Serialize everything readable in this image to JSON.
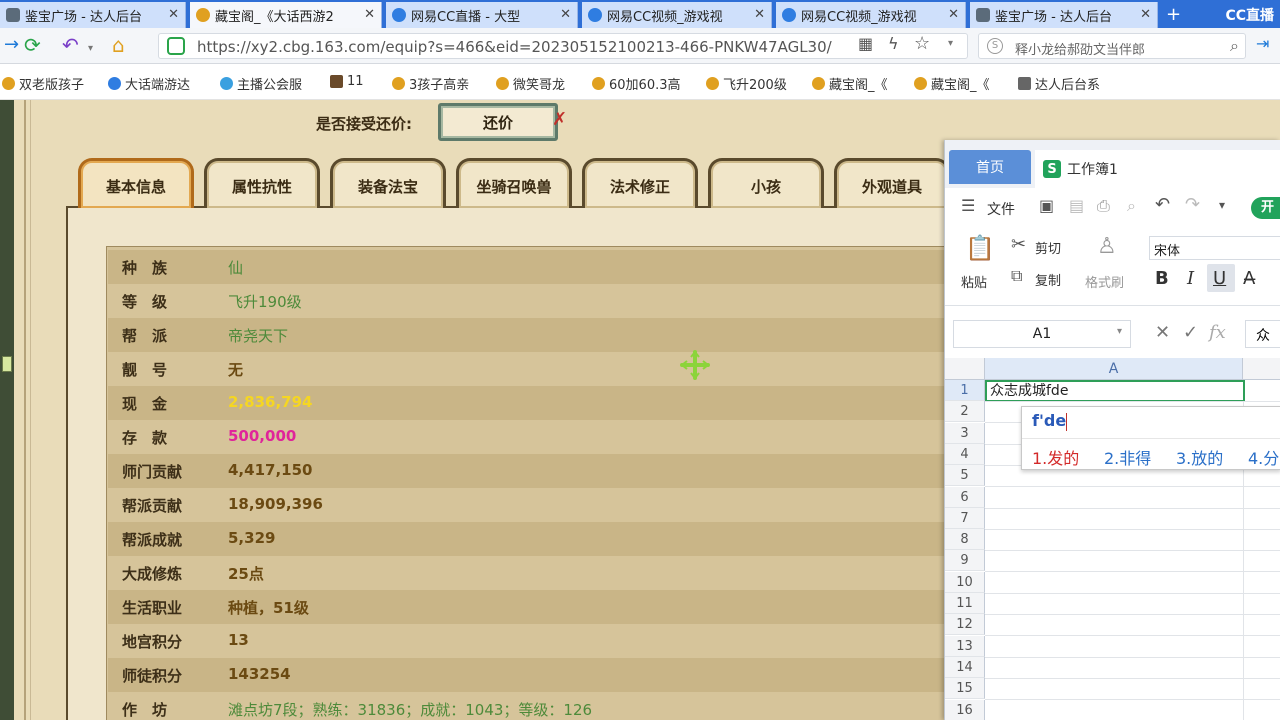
{
  "browser": {
    "tabs": [
      {
        "title": "鉴宝广场 - 达人后台",
        "active": false,
        "icon_color": "#5b6b7a"
      },
      {
        "title": "藏宝阁_《大话西游2",
        "active": true,
        "icon_color": "#e0a020"
      },
      {
        "title": "网易CC直播 - 大型",
        "active": false,
        "icon_color": "#2f7de1"
      },
      {
        "title": "网易CC视频_游戏视",
        "active": false,
        "icon_color": "#2f7de1"
      },
      {
        "title": "网易CC视频_游戏视",
        "active": false,
        "icon_color": "#2f7de1"
      },
      {
        "title": "鉴宝广场 - 达人后台",
        "active": false,
        "icon_color": "#5b6b7a"
      }
    ],
    "brand": "CC直播",
    "url": "https://xy2.cbg.163.com/equip?s=466&eid=202305152100213-466-PNKW47AGL30/",
    "search_placeholder": "释小龙给郝劭文当伴郎",
    "bookmarks": [
      "双老版孩子",
      "大话端游达",
      "主播公会服",
      "11",
      "3孩子高亲",
      "微笑哥龙",
      "60加60.3高",
      "飞升200级",
      "藏宝阁_《",
      "藏宝阁_《",
      "达人后台系"
    ]
  },
  "game": {
    "offer_label": "是否接受还价:",
    "offer_button": "还价",
    "tabs": [
      "基本信息",
      "属性抗性",
      "装备法宝",
      "坐骑召唤兽",
      "法术修正",
      "小孩",
      "外观道具"
    ],
    "active_tab": 0,
    "rows": [
      {
        "label": "种　族",
        "value": "仙",
        "style": "green"
      },
      {
        "label": "等　级",
        "value": "飞升190级",
        "style": "green"
      },
      {
        "label": "帮　派",
        "value": "帝尧天下",
        "style": "green"
      },
      {
        "label": "靓　号",
        "value": "无",
        "style": "brown"
      },
      {
        "label": "现　金",
        "value": "2,836,794",
        "style": "yellow"
      },
      {
        "label": "存　款",
        "value": "500,000",
        "style": "pink"
      },
      {
        "label": "师门贡献",
        "value": "4,417,150",
        "style": "brown"
      },
      {
        "label": "帮派贡献",
        "value": "18,909,396",
        "style": "brown"
      },
      {
        "label": "帮派成就",
        "value": "5,329",
        "style": "brown"
      },
      {
        "label": "大成修炼",
        "value": "25点",
        "style": "brown"
      },
      {
        "label": "生活职业",
        "value": "种植，51级",
        "style": "brown"
      },
      {
        "label": "地宫积分",
        "value": "13",
        "style": "brown"
      },
      {
        "label": "师徒积分",
        "value": "143254",
        "style": "brown"
      },
      {
        "label": "作　坊",
        "value": "滩点坊7段；熟练：31836；成就：1043；等级：126",
        "style": "green"
      }
    ]
  },
  "spreadsheet": {
    "home_tab": "首页",
    "workbook_tab": "工作簿1",
    "workbook_icon": "S",
    "menu_file": "文件",
    "menu_start": "开",
    "paste": "粘贴",
    "cut": "剪切",
    "copy": "复制",
    "format_painter": "格式刷",
    "font": "宋体",
    "cell_ref": "A1",
    "formula_preview": "众",
    "column_a": "A",
    "cell_a1": "众志成城fde",
    "row_numbers": [
      "1",
      "2",
      "3",
      "4",
      "5",
      "6",
      "7",
      "8",
      "9",
      "10",
      "11",
      "12",
      "13",
      "14",
      "15",
      "16"
    ],
    "ime": {
      "composition": "f'de",
      "candidates": [
        "1.发的",
        "2.非得",
        "3.放的",
        "4.分"
      ]
    }
  },
  "colors": {
    "tabbar": "#2f6fd6",
    "game_bg": "#e9dcb9",
    "excel_green": "#2e9e58"
  }
}
